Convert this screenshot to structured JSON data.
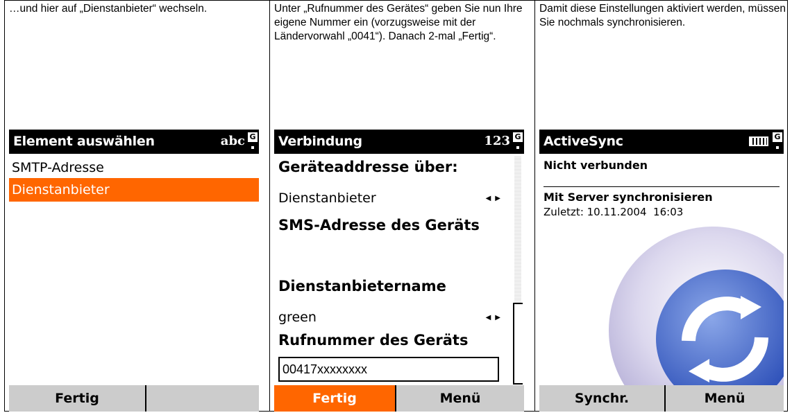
{
  "panels": [
    {
      "caption": "…und hier auf „Dienstanbieter“ wechseln.",
      "title": "Element auswählen",
      "indicator": "abc",
      "items": [
        "SMTP-Adresse",
        "Dienstanbieter"
      ],
      "softkeys": [
        "Fertig",
        ""
      ]
    },
    {
      "caption": "Unter „Rufnummer des Gerätes“ geben Sie nun Ihre eigene Nummer ein (vorzugsweise mit der Ländervorwahl „0041“). Danach 2-mal „Fertig“.",
      "title": "Verbindung",
      "indicator": "123",
      "label_address": "Geräteaddresse über:",
      "value_address": "Dienstanbieter",
      "label_sms": "SMS-Adresse des Geräts",
      "label_provider": "Dienstanbietername",
      "value_provider": "green",
      "label_phone": "Rufnummer des Geräts",
      "input_phone": "00417xxxxxxxx",
      "softkeys": [
        "Fertig",
        "Menü"
      ]
    },
    {
      "caption": "Damit diese Einstellungen aktiviert werden, müssen Sie nochmals synchronisieren.",
      "title": "ActiveSync",
      "status": "Nicht verbunden",
      "sync_heading": "Mit Server synchronisieren",
      "last_sync": "Zuletzt: 10.11.2004  16:03",
      "softkeys": [
        "Synchr.",
        "Menü"
      ]
    }
  ],
  "indicator_badge": "G",
  "colors": {
    "accent": "#ff6600",
    "softbar": "#cccccc",
    "titlebar": "#000000"
  }
}
